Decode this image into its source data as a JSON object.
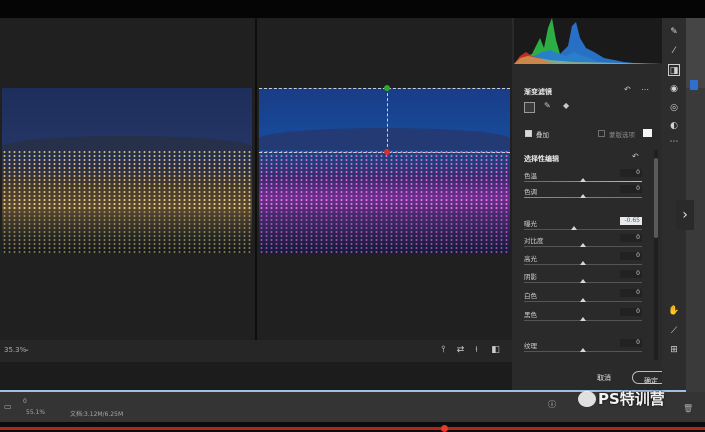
{
  "canvas": {
    "zoom": "35.3%"
  },
  "panel": {
    "gradient_section_title": "渐变滤镜",
    "gradient_reset_icon": "reset-arrow-icon",
    "gradient_more_icon": "more-icon",
    "overlay_label": "叠加",
    "overlay_checked": true,
    "new_option_label": "蒙版选项",
    "new_option_checked": false,
    "selective_title": "选择性编辑",
    "sliders": [
      {
        "label": "色温",
        "value": "0",
        "thumb": 0.5
      },
      {
        "label": "色调",
        "value": "0",
        "thumb": 0.5
      },
      {
        "label": "曝光",
        "value": "-0.65",
        "thumb": 0.42,
        "active": true
      },
      {
        "label": "对比度",
        "value": "0",
        "thumb": 0.5
      },
      {
        "label": "高光",
        "value": "0",
        "thumb": 0.5
      },
      {
        "label": "阴影",
        "value": "0",
        "thumb": 0.5
      },
      {
        "label": "白色",
        "value": "0",
        "thumb": 0.5
      },
      {
        "label": "黑色",
        "value": "0",
        "thumb": 0.5
      },
      {
        "label": "纹理",
        "value": "0",
        "thumb": 0.5
      }
    ],
    "cancel_label": "取消",
    "ok_label": "确定"
  },
  "status": {
    "page_zoom": "55.1%",
    "doc_info": "文档:3.12M/6.25M",
    "left_marker": "0"
  },
  "watermark": "PS特训营",
  "colors": {
    "accent": "#2e6fd0",
    "pin_top": "#2fa832",
    "pin_bottom": "#d43030"
  }
}
